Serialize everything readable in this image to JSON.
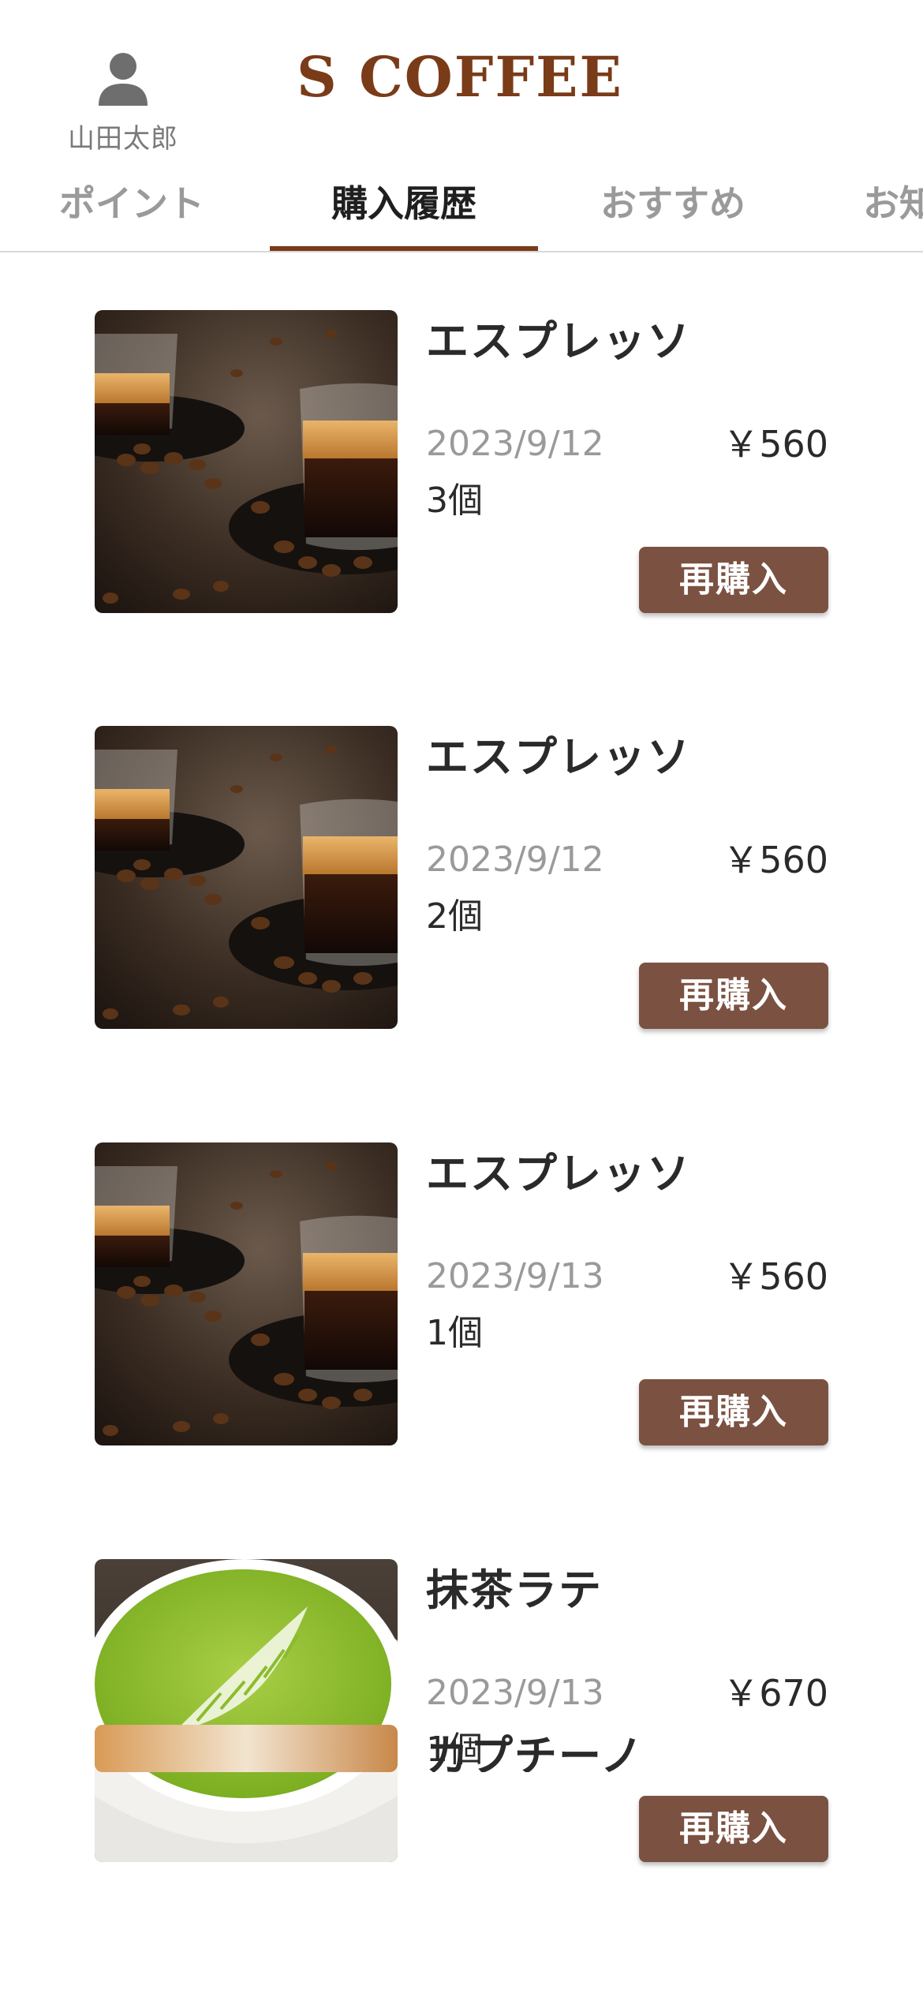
{
  "user": {
    "name": "山田太郎",
    "icon": "user-icon"
  },
  "brand": {
    "title": "S COFFEE",
    "color": "#7a3b18"
  },
  "tabs": [
    {
      "label": "ポイント",
      "active": false
    },
    {
      "label": "購入履歴",
      "active": true
    },
    {
      "label": "おすすめ",
      "active": false
    },
    {
      "label": "お知",
      "active": false
    }
  ],
  "orders": [
    {
      "name": "エスプレッソ",
      "date": "2023/9/12",
      "price": "￥560",
      "qty": "3個",
      "button": "再購入",
      "image": "espresso-photo"
    },
    {
      "name": "エスプレッソ",
      "date": "2023/9/12",
      "price": "￥560",
      "qty": "2個",
      "button": "再購入",
      "image": "espresso-photo"
    },
    {
      "name": "エスプレッソ",
      "date": "2023/9/13",
      "price": "￥560",
      "qty": "1個",
      "button": "再購入",
      "image": "espresso-photo"
    },
    {
      "name": "抹茶ラテ",
      "date": "2023/9/13",
      "price": "￥670",
      "qty": "1個",
      "button": "再購入",
      "image": "matcha-latte-photo"
    }
  ],
  "partial_item": {
    "name": "カプチーノ",
    "image": "cappuccino-photo"
  },
  "colors": {
    "accent": "#7a3b18",
    "button": "#7b5141"
  }
}
